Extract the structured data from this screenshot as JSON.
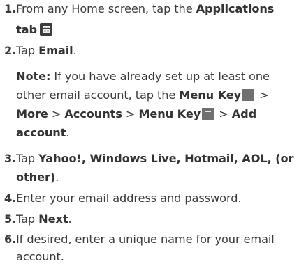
{
  "steps": [
    {
      "num": "1.",
      "line1": {
        "t1": "From any Home screen, tap the ",
        "b1": "Applications"
      },
      "line2": {
        "b1": "tab",
        "icon": "applications-grid-icon"
      }
    },
    {
      "num": "2.",
      "line1": {
        "t1": "Tap ",
        "b1": "Email",
        "t2": "."
      },
      "note": {
        "line1": {
          "b1": "Note:",
          "t1": " If you have already set up at least one"
        },
        "line2": {
          "t1": "other email account, tap the ",
          "b1": "Menu Key",
          "t2": " >"
        },
        "line3": {
          "b1": "More",
          "t1": " > ",
          "b2": "Accounts",
          "t2": " > ",
          "b3": "Menu Key",
          "t3": " > ",
          "b4": "Add"
        },
        "line4": {
          "b1": "account",
          "t1": "."
        }
      }
    },
    {
      "num": "3.",
      "line1": {
        "t1": "Tap ",
        "b1": "Yahoo!, Windows Live, Hotmail, AOL, (or"
      },
      "line2": {
        "b1": "other)",
        "t1": "."
      }
    },
    {
      "num": "4.",
      "line1": {
        "t1": "Enter your email address and password."
      }
    },
    {
      "num": "5.",
      "line1": {
        "t1": "Tap ",
        "b1": "Next",
        "t2": "."
      }
    },
    {
      "num": "6.",
      "line1": {
        "t1": "If desired, enter a unique name for your email"
      },
      "line2": {
        "t1": "account."
      }
    }
  ],
  "icons": {
    "menu_key": "menu-key-icon",
    "menu_key_color": "#707070",
    "apps_color": "#3c3c3c"
  }
}
